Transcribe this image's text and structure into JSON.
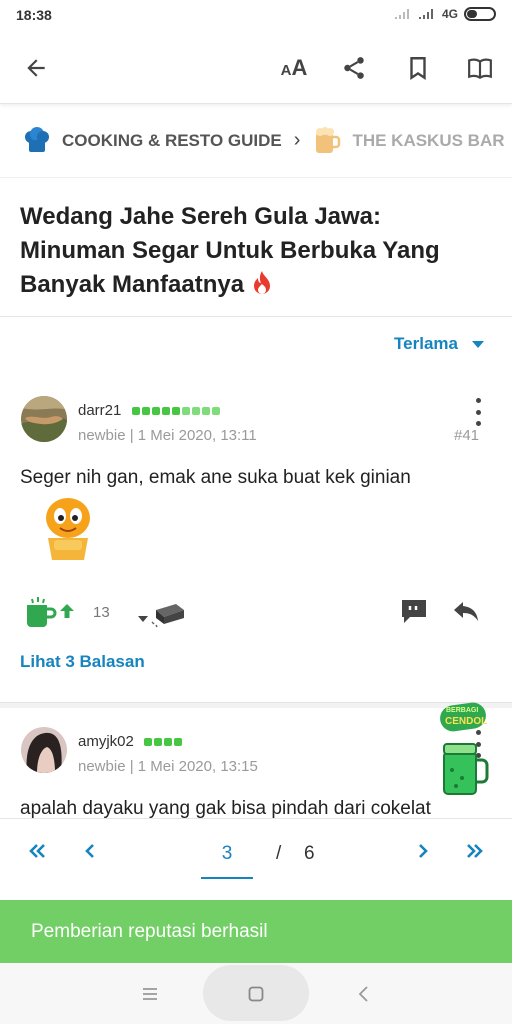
{
  "status_bar": {
    "time": "18:38",
    "network": "4G"
  },
  "toolbar": {
    "back_icon": "arrow-left-icon",
    "font_size_label": "AA",
    "share_icon": "share-icon",
    "bookmark_icon": "bookmark-icon",
    "reader_icon": "open-book-icon"
  },
  "breadcrumb": {
    "items": [
      {
        "label": "COOKING & RESTO GUIDE",
        "icon": "chef-hat-icon"
      },
      {
        "label": "THE KASKUS BAR",
        "icon": "beer-mug-icon"
      }
    ]
  },
  "thread": {
    "title": "Wedang Jahe Sereh Gula Jawa: Minuman Segar Untuk Berbuka Yang Banyak Manfaatnya",
    "hot_icon": "fire-icon"
  },
  "sort": {
    "label": "Terlama"
  },
  "posts": [
    {
      "username": "darr21",
      "reputation_dots": 9,
      "meta": "newbie | 1 Mei 2020, 13:11",
      "number": "#41",
      "text": "Seger nih gan, emak ane suka buat kek ginian",
      "emoticon": "smiley-emoticon",
      "cendol_count": "13",
      "replies_label": "Lihat 3 Balasan"
    },
    {
      "username": "amyjk02",
      "reputation_dots": 4,
      "meta": "newbie | 1 Mei 2020, 13:15",
      "text": "apalah dayaku yang gak bisa pindah dari cokelat"
    }
  ],
  "cendol_badge": {
    "top": "BERBAGI",
    "bottom": "CENDOL"
  },
  "pagination": {
    "current": "3",
    "separator": "/",
    "total": "6"
  },
  "toast": {
    "message": "Pemberian reputasi berhasil"
  },
  "colors": {
    "accent": "#1684bf",
    "reputation": "#46c642",
    "toast": "#72cf66"
  }
}
